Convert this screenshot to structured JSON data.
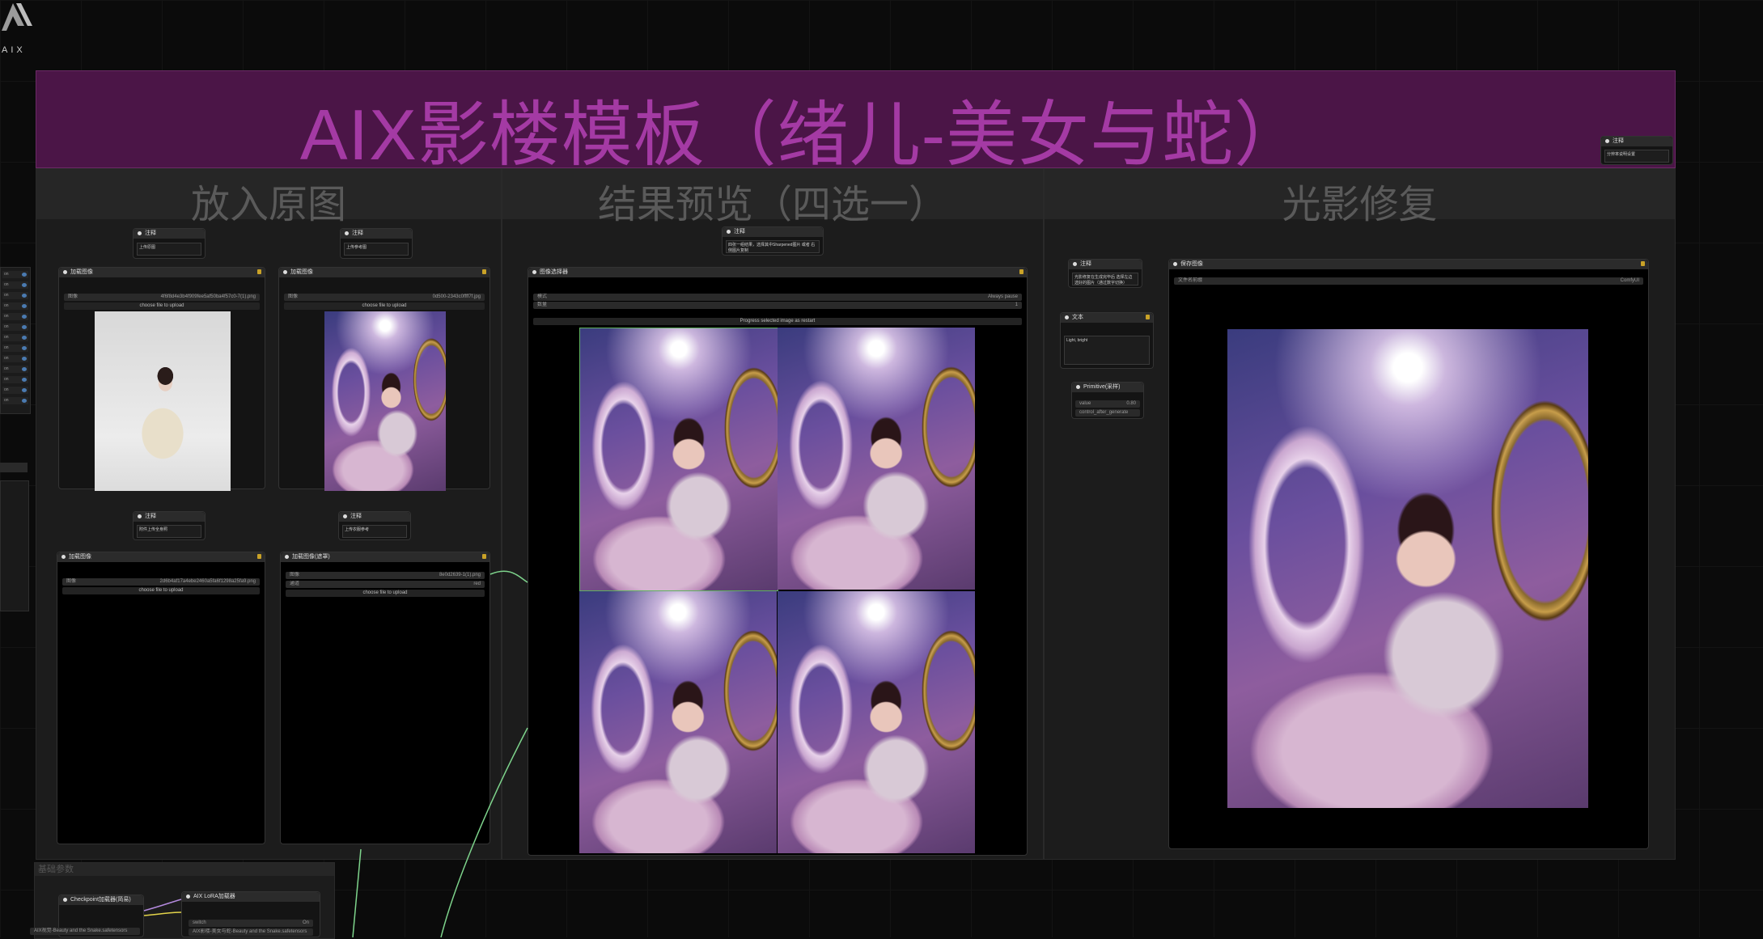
{
  "logo": {
    "text": "AIX"
  },
  "banner": {
    "title": "AIX影楼模板（绪儿-美女与蛇）"
  },
  "groups": {
    "input": {
      "title": "放入原图"
    },
    "preview": {
      "title": "结果预览（四选一）"
    },
    "relight": {
      "title": "光影修复"
    },
    "base_params": {
      "title": "基础参数"
    }
  },
  "notes": {
    "note1": {
      "title": "注释",
      "body": "上传原图"
    },
    "note2": {
      "title": "注释",
      "body": "上传参考图"
    },
    "note3": {
      "title": "注释",
      "body": "附件上传全身照"
    },
    "note4": {
      "title": "注释",
      "body": "上传衣服参考"
    },
    "note5": {
      "title": "注释",
      "body": "四张一组结果，选择其中Sharpened图片 或者 右侧图片复制"
    },
    "note6": {
      "title": "注释",
      "body": "光影修复在生成完毕后\n选择左边选好的图片（通过数字切换）"
    },
    "note_top_right": {
      "title": "注释",
      "body": "分辨率说明设置"
    }
  },
  "load_nodes": {
    "load1": {
      "title": "加载图像",
      "field_label": "图像",
      "file": "4f6f8d4e3b4f909fee5af50ba4f57c0-7(1).png",
      "upload": "choose file to upload"
    },
    "load2": {
      "title": "加载图像",
      "field_label": "图像",
      "file": "0d500-2343c0ffff7f.jpg",
      "upload": "choose file to upload"
    },
    "load3": {
      "title": "加载图像",
      "field_label": "图像",
      "file": "2d6b4af17a4ebe2460a5fa6f1298a25fa9.png",
      "upload": "choose file to upload"
    },
    "load4": {
      "title": "加载图像(遮罩)",
      "field_label": "图像",
      "file": "8e0d2639-1(1).png",
      "mask_label": "通道",
      "mask_value": "red",
      "upload": "choose file to upload"
    }
  },
  "preview_node": {
    "title": "图像选择器",
    "row1_label": "模式",
    "row1_value": "Always pause",
    "row2_label": "数量",
    "row2_value": "1",
    "progress_btn": "Progress selected image as restart"
  },
  "relight_nodes": {
    "text_node": {
      "title": "文本",
      "body": "Light, bright"
    },
    "sampler_node": {
      "title": "Primitive(采样)",
      "row1_label": "value",
      "row1_value": "0.80",
      "row2_label": "control_after_generate",
      "row2_value": "fixed"
    },
    "output_node": {
      "title": "保存图像",
      "field_label": "文件名前缀",
      "field_value": "ComfyUI"
    }
  },
  "bottom_nodes": {
    "checkpoint": {
      "title": "Checkpoint加载器(简易)",
      "value": "AIX视觉-Beauty and the Snake.safetensors"
    },
    "lora": {
      "title": "AIX LoRA加载器",
      "row1": "switch",
      "row1_value": "On",
      "row2": "lora名称",
      "row2_value": "AIX影楼-美女与蛇-Beauty and the Snake.safetensors"
    }
  },
  "left_panel": {
    "items": [
      "on",
      "on",
      "on",
      "on",
      "on",
      "on",
      "on",
      "on",
      "on",
      "on",
      "on",
      "on",
      "on"
    ]
  },
  "colors": {
    "banner_bg": "#4b1547",
    "banner_text": "#a43aa4",
    "group_head": "#262626",
    "group_title": "#5a5a5a"
  }
}
